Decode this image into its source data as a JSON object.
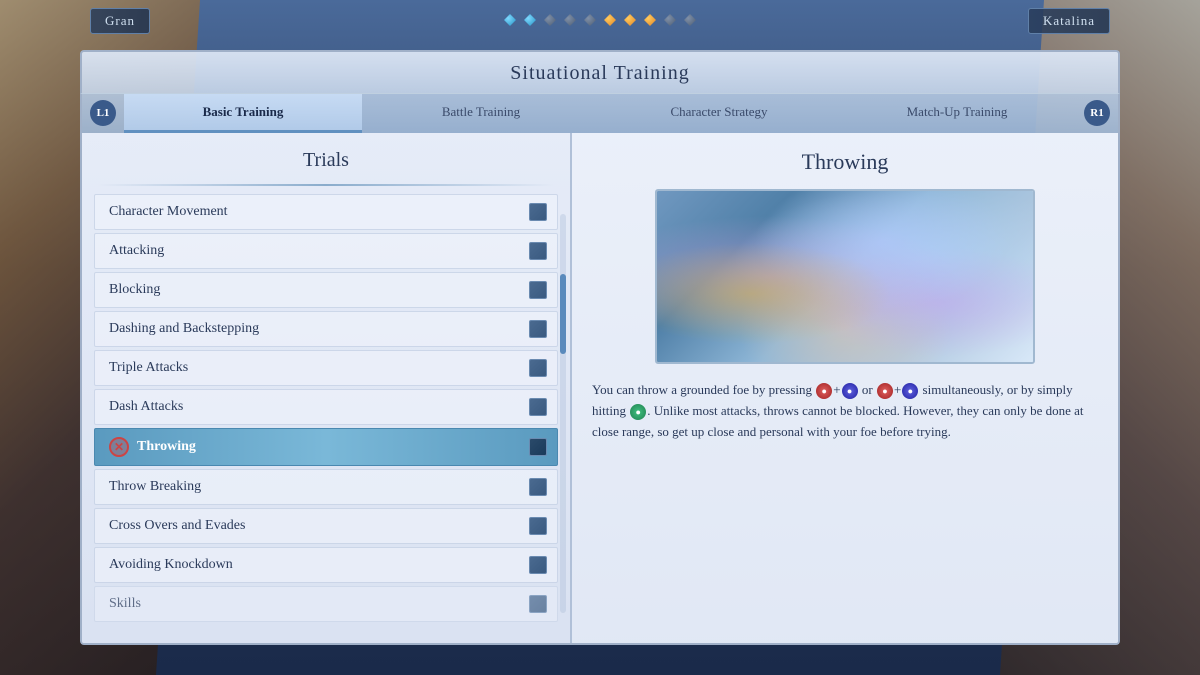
{
  "title": "Situational Training",
  "name_left": "Gran",
  "name_right": "Katalina",
  "tabs": [
    {
      "label": "L1",
      "type": "button"
    },
    {
      "label": "Basic Training",
      "active": true
    },
    {
      "label": "Battle Training"
    },
    {
      "label": "Character Strategy"
    },
    {
      "label": "Match-Up Training"
    },
    {
      "label": "R1",
      "type": "button"
    }
  ],
  "trials_heading": "Trials",
  "trials": [
    {
      "label": "Character Movement",
      "active": false
    },
    {
      "label": "Attacking",
      "active": false
    },
    {
      "label": "Blocking",
      "active": false
    },
    {
      "label": "Dashing and Backstepping",
      "active": false
    },
    {
      "label": "Triple Attacks",
      "active": false
    },
    {
      "label": "Dash Attacks",
      "active": false
    },
    {
      "label": "Throwing",
      "active": true
    },
    {
      "label": "Throw Breaking",
      "active": false
    },
    {
      "label": "Cross Overs and Evades",
      "active": false
    },
    {
      "label": "Avoiding Knockdown",
      "active": false
    },
    {
      "label": "Skills",
      "active": false
    }
  ],
  "detail": {
    "title": "Throwing",
    "description_parts": [
      "You can throw a grounded foe by pressing ",
      "+",
      " or ",
      "+",
      " simultaneously, or by simply hitting ",
      ". Unlike most attacks, throws cannot be blocked. However, they can only be done at close range, so get up close and personal with your foe before trying."
    ],
    "description_full": "You can throw a grounded foe by pressing ●+● or ●+● simultaneously, or by simply hitting ●. Unlike most attacks, throws cannot be blocked. However, they can only be done at close range, so get up close and personal with your foe before trying."
  },
  "gems_left": [
    "active",
    "active",
    "inactive",
    "inactive",
    "inactive"
  ],
  "gems_right": [
    "active",
    "active",
    "active",
    "inactive",
    "inactive"
  ]
}
